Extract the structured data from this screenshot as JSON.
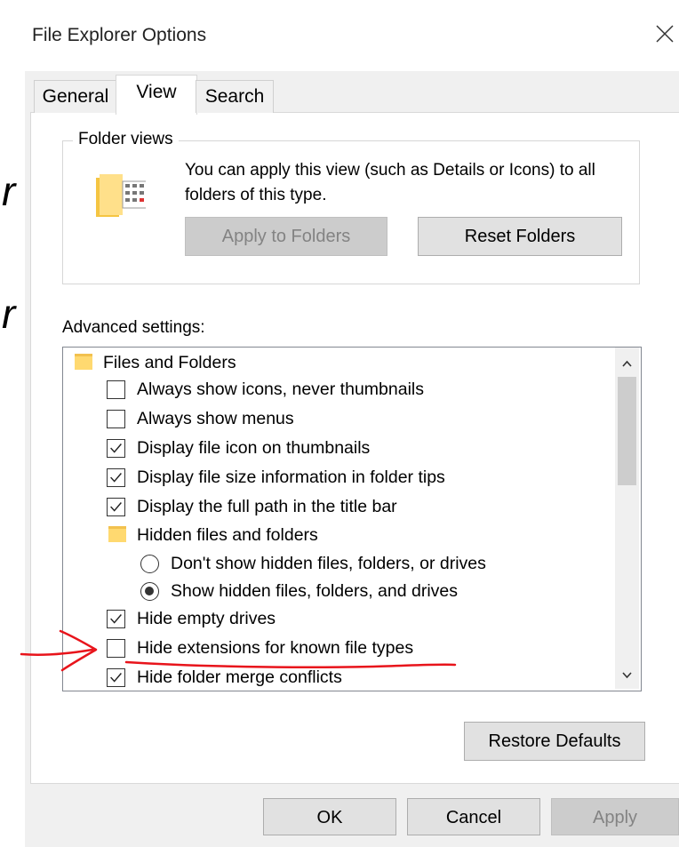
{
  "window": {
    "title": "File Explorer Options"
  },
  "tabs": [
    {
      "label": "General",
      "active": false
    },
    {
      "label": "View",
      "active": true
    },
    {
      "label": "Search",
      "active": false
    }
  ],
  "folder_views": {
    "group_label": "Folder views",
    "description": "You can apply this view (such as Details or Icons) to all folders of this type.",
    "apply_button": "Apply to Folders",
    "reset_button": "Reset Folders"
  },
  "advanced": {
    "label": "Advanced settings:",
    "items": [
      {
        "type": "folder",
        "label": "Files and Folders"
      },
      {
        "type": "checkbox",
        "label": "Always show icons, never thumbnails",
        "checked": false
      },
      {
        "type": "checkbox",
        "label": "Always show menus",
        "checked": false
      },
      {
        "type": "checkbox",
        "label": "Display file icon on thumbnails",
        "checked": true
      },
      {
        "type": "checkbox",
        "label": "Display file size information in folder tips",
        "checked": true
      },
      {
        "type": "checkbox",
        "label": "Display the full path in the title bar",
        "checked": true
      },
      {
        "type": "folder",
        "label": "Hidden files and folders"
      },
      {
        "type": "radio",
        "label": "Don't show hidden files, folders, or drives",
        "selected": false
      },
      {
        "type": "radio",
        "label": "Show hidden files, folders, and drives",
        "selected": true
      },
      {
        "type": "checkbox",
        "label": "Hide empty drives",
        "checked": true
      },
      {
        "type": "checkbox",
        "label": "Hide extensions for known file types",
        "checked": false
      },
      {
        "type": "checkbox",
        "label": "Hide folder merge conflicts",
        "checked": true
      }
    ],
    "restore_button": "Restore Defaults"
  },
  "footer": {
    "ok": "OK",
    "cancel": "Cancel",
    "apply": "Apply"
  },
  "background_fragments": [
    "r",
    "r"
  ],
  "colors": {
    "annotation": "#e8141b",
    "folder": "#ffd970",
    "disabled_text": "#838383"
  }
}
